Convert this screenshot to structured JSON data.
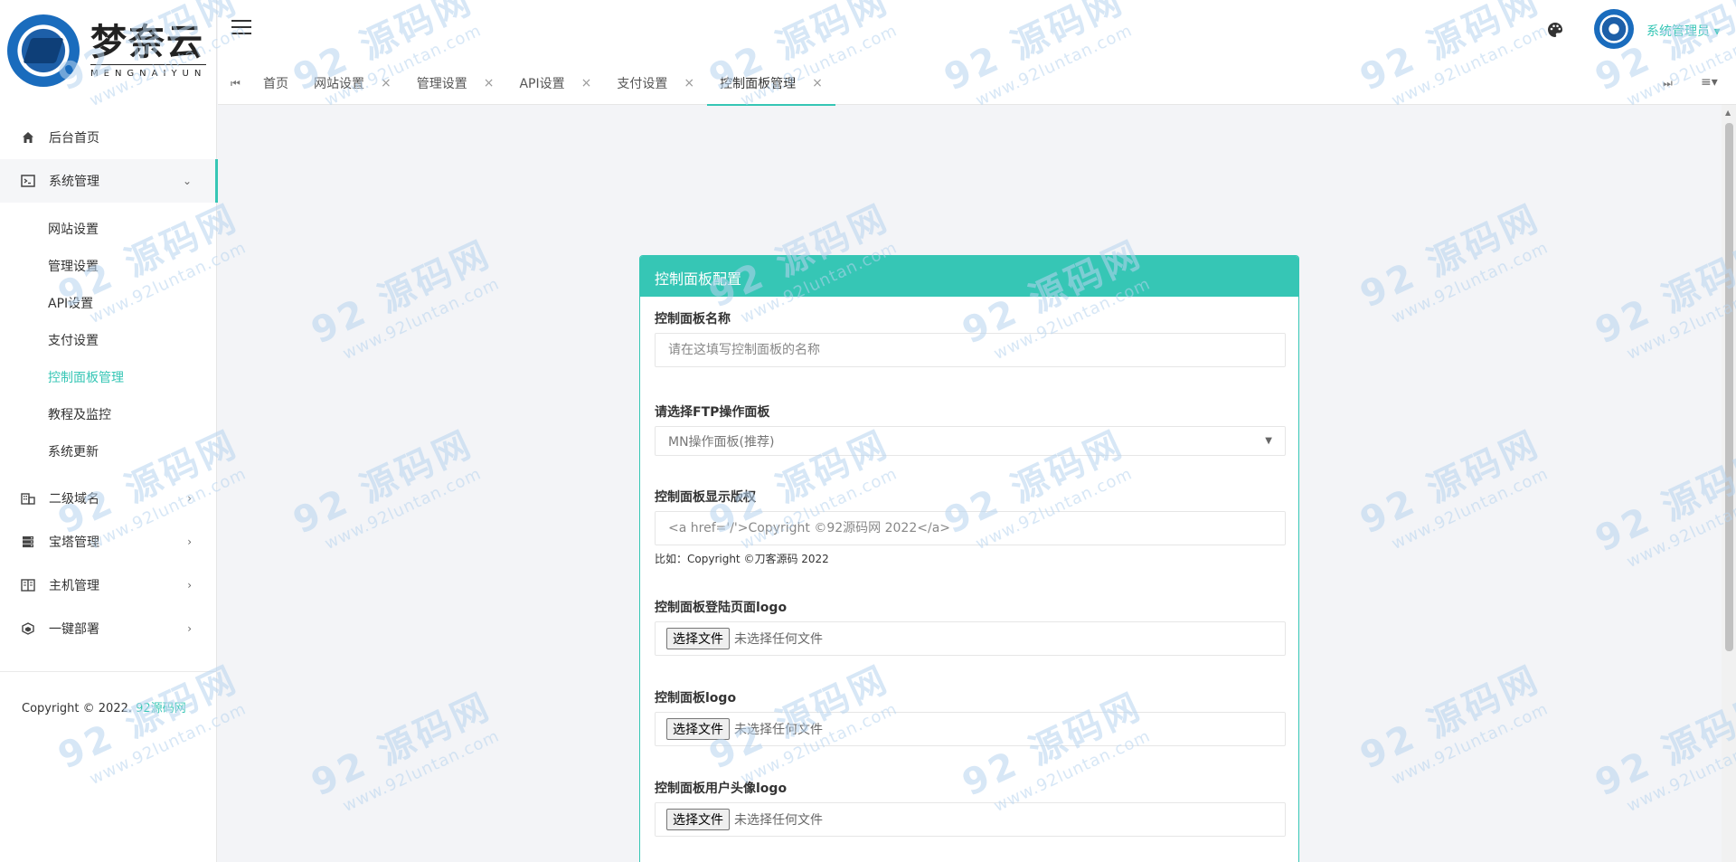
{
  "brand": {
    "name": "梦奈云",
    "subtitle": "MENGNAIYUN"
  },
  "header": {
    "username": "系统管理员",
    "user_caret": "▾"
  },
  "sidebar": {
    "items": [
      {
        "label": "后台首页",
        "icon": "home-icon"
      },
      {
        "label": "系统管理",
        "icon": "terminal-icon",
        "expanded": true,
        "chevron": "⌄"
      },
      {
        "label": "二级域名",
        "icon": "building-icon",
        "chevron": "›"
      },
      {
        "label": "宝塔管理",
        "icon": "server-icon",
        "chevron": "›"
      },
      {
        "label": "主机管理",
        "icon": "columns-icon",
        "chevron": "›"
      },
      {
        "label": "一键部署",
        "icon": "cube-icon",
        "chevron": "›"
      }
    ],
    "sub_items": [
      {
        "label": "网站设置"
      },
      {
        "label": "管理设置"
      },
      {
        "label": "API设置"
      },
      {
        "label": "支付设置"
      },
      {
        "label": "控制面板管理",
        "current": true
      },
      {
        "label": "教程及监控"
      },
      {
        "label": "系统更新"
      }
    ],
    "copyright_prefix": "Copyright © 2022.",
    "copyright_link": "92源码网"
  },
  "tabs": [
    {
      "label": "首页",
      "closable": false
    },
    {
      "label": "网站设置",
      "closable": true
    },
    {
      "label": "管理设置",
      "closable": true
    },
    {
      "label": "API设置",
      "closable": true
    },
    {
      "label": "支付设置",
      "closable": true
    },
    {
      "label": "控制面板管理",
      "closable": true,
      "active": true
    }
  ],
  "tab_close_glyph": "×",
  "card": {
    "title": "控制面板配置",
    "name_field": {
      "label": "控制面板名称",
      "placeholder": "请在这填写控制面板的名称"
    },
    "ftp_field": {
      "label": "请选择FTP操作面板",
      "value": "MN操作面板(推荐)"
    },
    "copyright_field": {
      "label": "控制面板显示版权",
      "placeholder": "<a href='/'>Copyright ©92源码网 2022</a>",
      "hint": "比如：Copyright ©刀客源码 2022"
    },
    "login_logo_field": {
      "label": "控制面板登陆页面logo",
      "button": "选择文件",
      "status": "未选择任何文件"
    },
    "logo_field": {
      "label": "控制面板logo",
      "button": "选择文件",
      "status": "未选择任何文件"
    },
    "avatar_logo_field": {
      "label": "控制面板用户头像logo",
      "button": "选择文件",
      "status": "未选择任何文件"
    }
  },
  "watermark": {
    "main": "92 源码网",
    "url": "www.92luntan.com"
  },
  "colors": {
    "accent": "#36c6b5",
    "brand_blue": "#1a6cbd"
  }
}
